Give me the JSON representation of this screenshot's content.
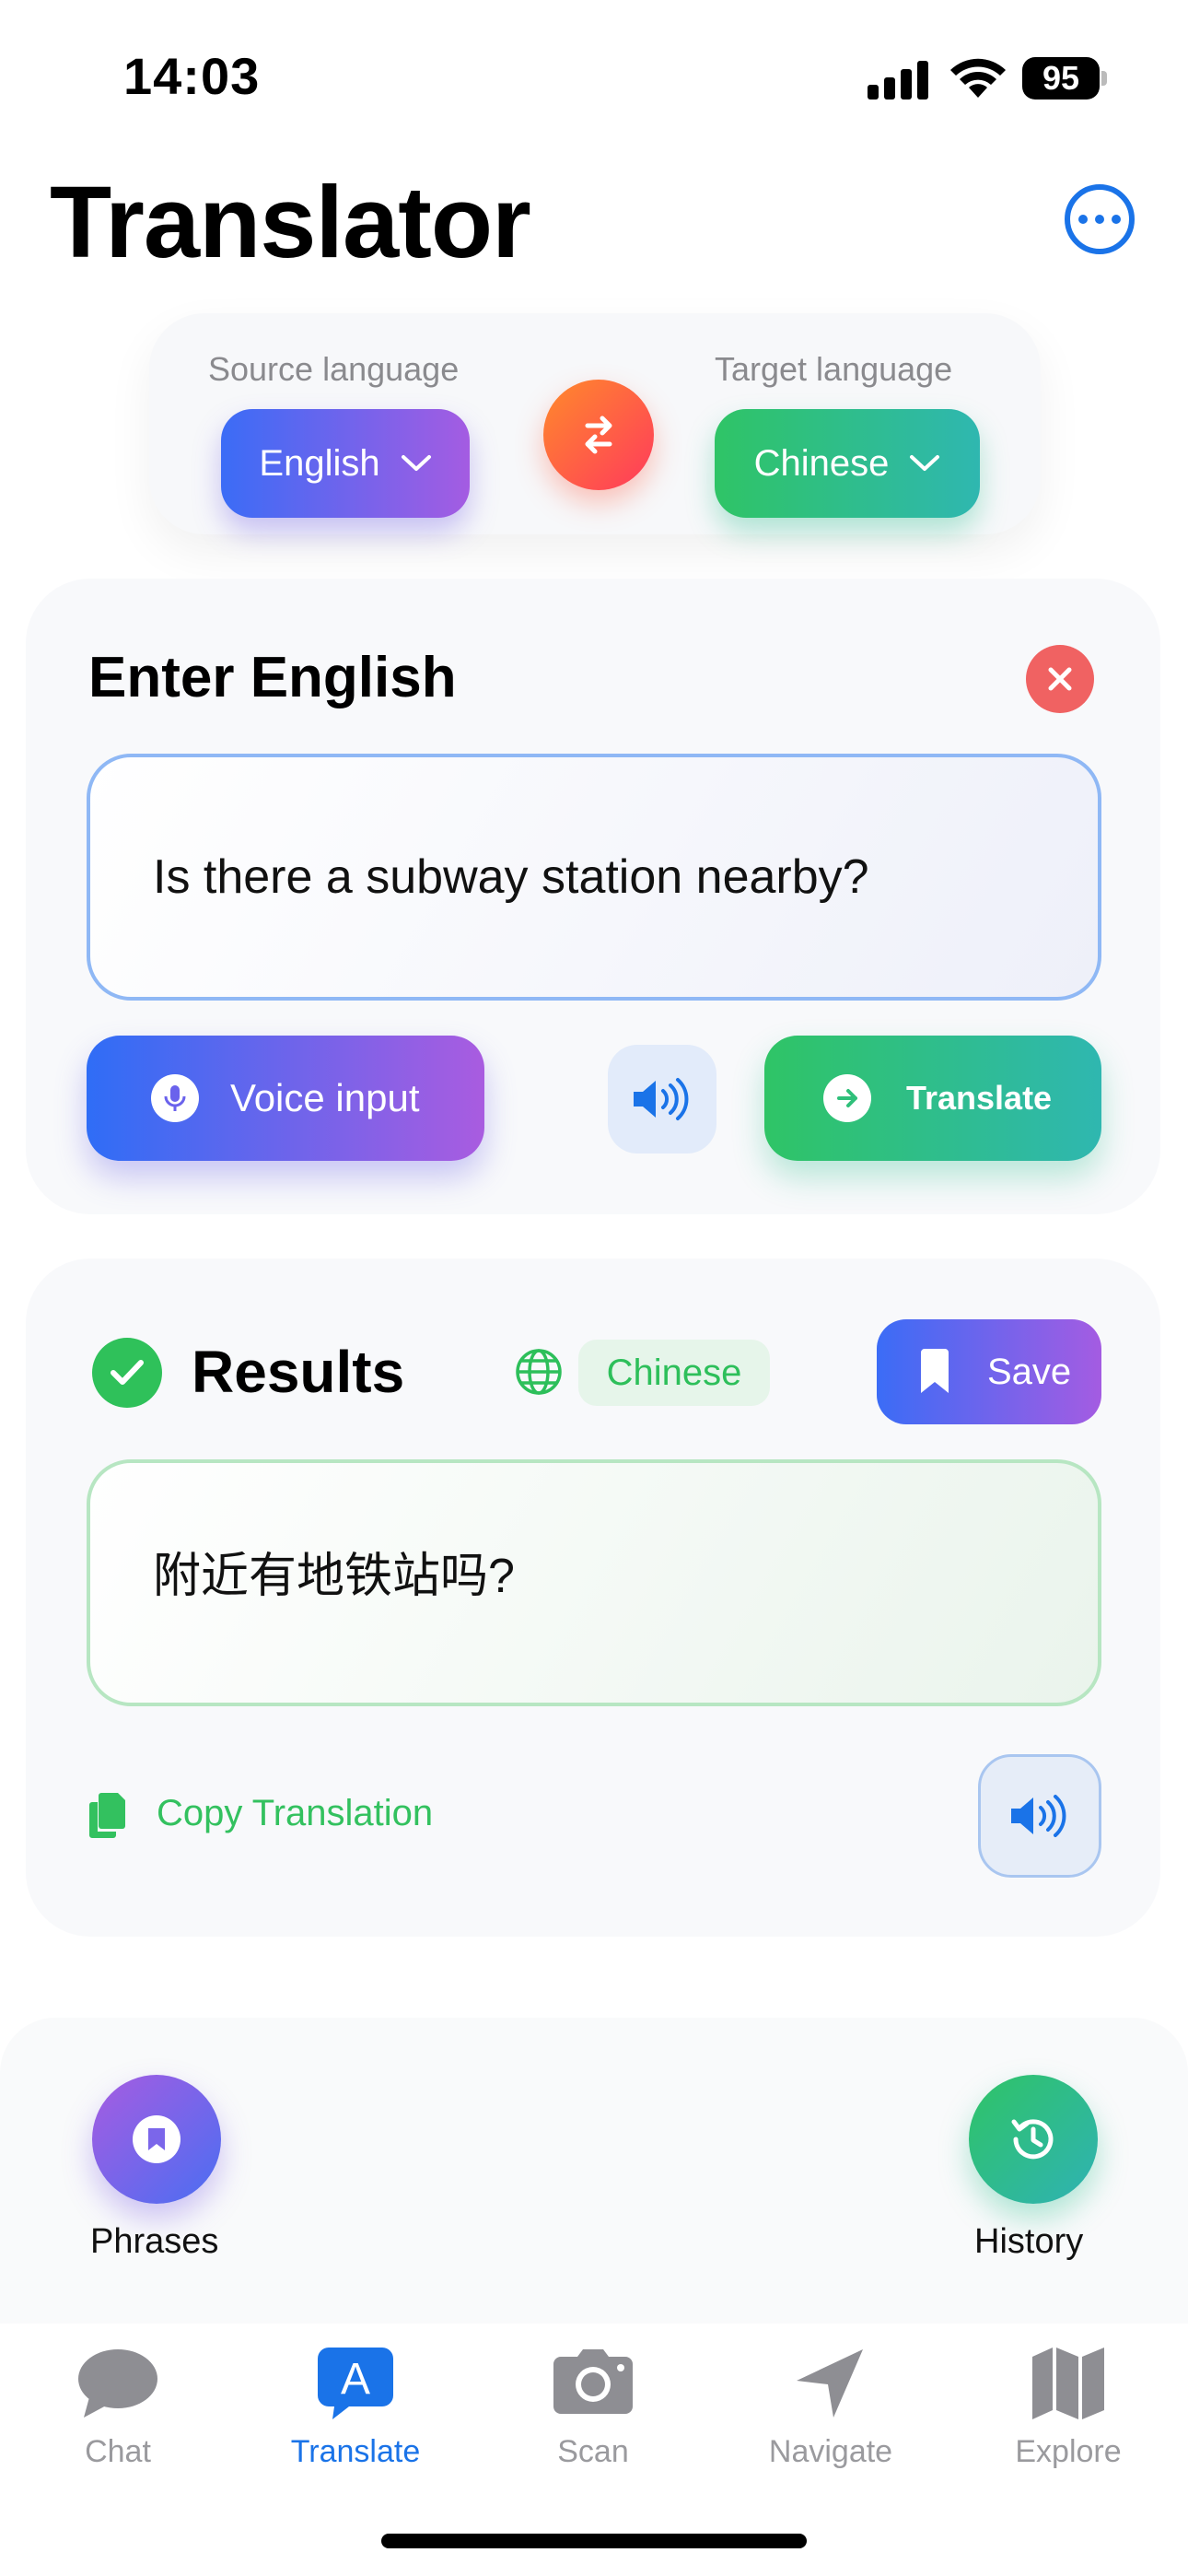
{
  "status_bar": {
    "time": "14:03",
    "battery": "95"
  },
  "header": {
    "title": "Translator",
    "more_icon": "ellipsis-circle-icon"
  },
  "language_selector": {
    "source_label": "Source language",
    "source_value": "English",
    "target_label": "Target language",
    "target_value": "Chinese",
    "swap_icon": "swap-arrows-icon"
  },
  "input_card": {
    "title": "Enter English",
    "text": "Is there a subway station nearby?",
    "voice_label": "Voice input",
    "translate_label": "Translate"
  },
  "results_card": {
    "title": "Results",
    "language_tag": "Chinese",
    "save_label": "Save",
    "translation": "附近有地铁站吗?",
    "copy_label": "Copy Translation"
  },
  "quick_actions": {
    "phrases_label": "Phrases",
    "history_label": "History"
  },
  "tabs": [
    {
      "label": "Chat",
      "icon": "chat-bubble-icon",
      "active": false
    },
    {
      "label": "Translate",
      "icon": "translate-icon",
      "active": true
    },
    {
      "label": "Scan",
      "icon": "camera-icon",
      "active": false
    },
    {
      "label": "Navigate",
      "icon": "location-arrow-icon",
      "active": false
    },
    {
      "label": "Explore",
      "icon": "map-icon",
      "active": false
    }
  ],
  "colors": {
    "accent_blue": "#1a73e8",
    "green": "#2fc466",
    "purple_gradient_end": "#a45ce2",
    "close_red": "#f06262"
  }
}
